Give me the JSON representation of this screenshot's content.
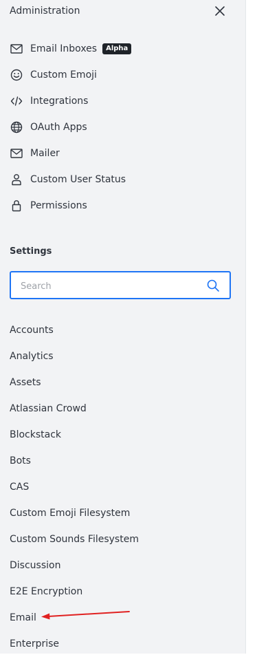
{
  "header": {
    "title": "Administration"
  },
  "admin_items": [
    {
      "label": "Email Inboxes",
      "icon": "mail-icon",
      "badge": "Alpha"
    },
    {
      "label": "Custom Emoji",
      "icon": "smiley-icon"
    },
    {
      "label": "Integrations",
      "icon": "code-icon"
    },
    {
      "label": "OAuth Apps",
      "icon": "globe-icon"
    },
    {
      "label": "Mailer",
      "icon": "mail-icon"
    },
    {
      "label": "Custom User Status",
      "icon": "user-icon"
    },
    {
      "label": "Permissions",
      "icon": "lock-icon"
    }
  ],
  "settings": {
    "title": "Settings",
    "search_placeholder": "Search",
    "items": [
      "Accounts",
      "Analytics",
      "Assets",
      "Atlassian Crowd",
      "Blockstack",
      "Bots",
      "CAS",
      "Custom Emoji Filesystem",
      "Custom Sounds Filesystem",
      "Discussion",
      "E2E Encryption",
      "Email",
      "Enterprise"
    ]
  },
  "colors": {
    "panel_bg": "#f2f3f5",
    "accent": "#1d74f5",
    "arrow": "#e02020"
  }
}
